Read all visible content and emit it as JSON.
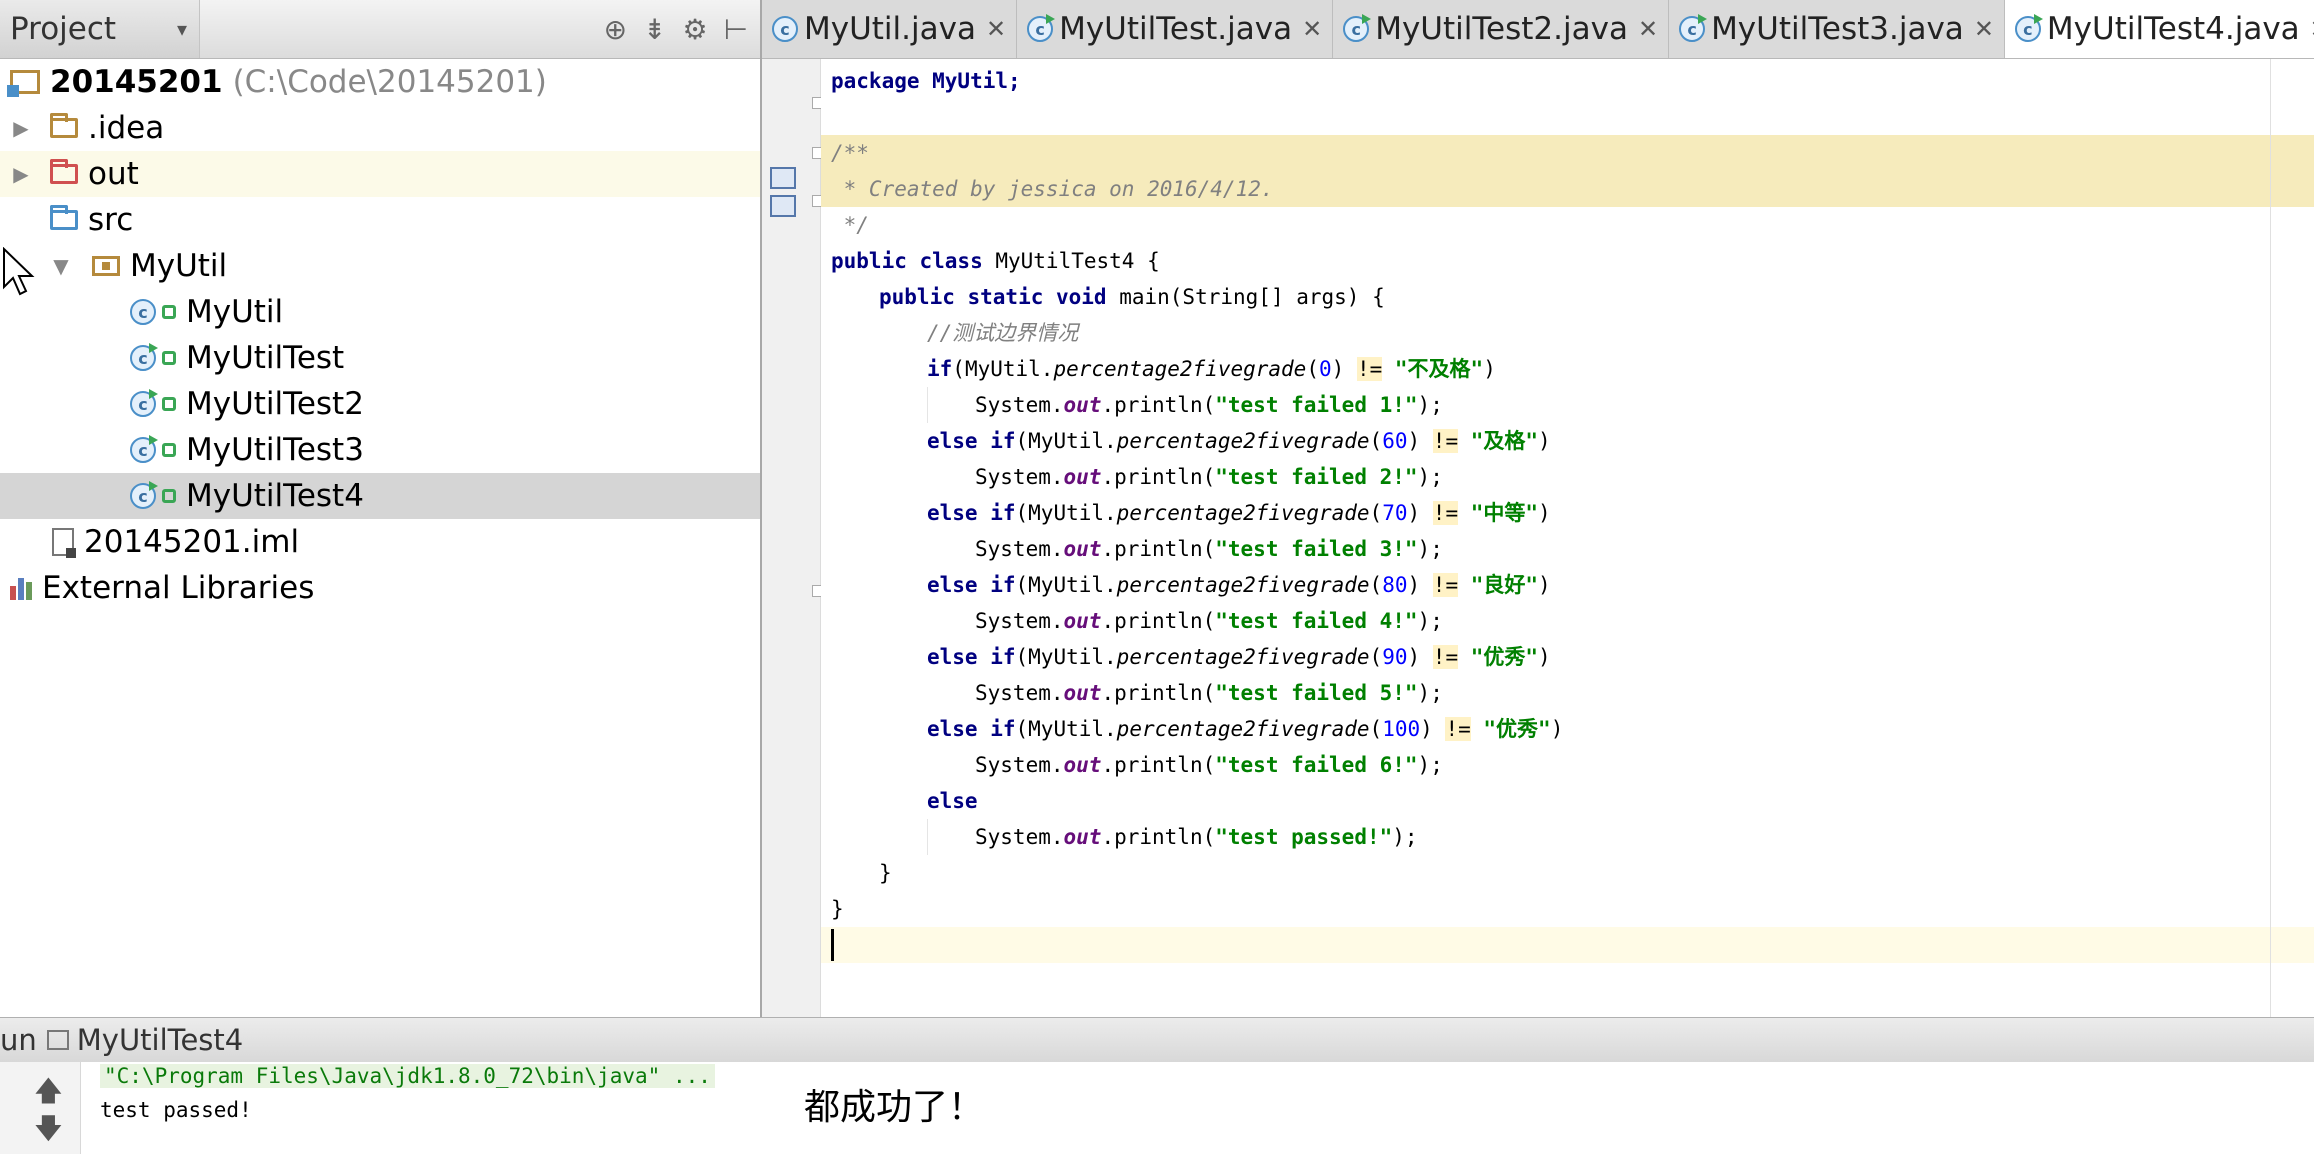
{
  "project_panel": {
    "title": "Project",
    "title_dropdown_icon": "chevron-down-icon",
    "tools": [
      "crosshair-icon",
      "collapse-icon",
      "gear-icon",
      "hide-icon"
    ],
    "root": {
      "name": "20145201",
      "path": "(C:\\Code\\20145201)"
    },
    "items": [
      {
        "label": ".idea",
        "icon": "folder-icon"
      },
      {
        "label": "out",
        "icon": "folder-excluded-icon"
      },
      {
        "label": "src",
        "icon": "source-folder-icon"
      },
      {
        "label": "MyUtil",
        "icon": "package-icon"
      },
      {
        "label": "MyUtil",
        "icon": "class-icon"
      },
      {
        "label": "MyUtilTest",
        "icon": "runnable-class-icon"
      },
      {
        "label": "MyUtilTest2",
        "icon": "runnable-class-icon"
      },
      {
        "label": "MyUtilTest3",
        "icon": "runnable-class-icon"
      },
      {
        "label": "MyUtilTest4",
        "icon": "runnable-class-icon",
        "selected": true
      },
      {
        "label": "20145201.iml",
        "icon": "module-file-icon"
      },
      {
        "label": "External Libraries",
        "icon": "library-icon"
      }
    ]
  },
  "editor": {
    "tabs": [
      {
        "label": "MyUtil.java",
        "active": false
      },
      {
        "label": "MyUtilTest.java",
        "active": false
      },
      {
        "label": "MyUtilTest2.java",
        "active": false
      },
      {
        "label": "MyUtilTest3.java",
        "active": false
      },
      {
        "label": "MyUtilTest4.java",
        "active": true
      }
    ],
    "code": {
      "l1": "package MyUtil;",
      "c1": "/**",
      "c2": " * Created by jessica on 2016/4/12.",
      "c3": " */",
      "l5_kw": "public class",
      "l5_name": " MyUtilTest4 {",
      "l6_kw": "public static void",
      "l6_rest": " main(String[] args) {",
      "l7": "//测试边界情况",
      "kw_if": "if",
      "kw_elseif": "else if",
      "kw_else": "else",
      "call_prefix": "(MyUtil.",
      "method": "percentage2fivegrade",
      "ne": "!=",
      "args": [
        "0",
        "60",
        "70",
        "80",
        "90",
        "100"
      ],
      "grades": [
        "\"不及格\"",
        "\"及格\"",
        "\"中等\"",
        "\"良好\"",
        "\"优秀\"",
        "\"优秀\""
      ],
      "print_prefix": "System.",
      "print_field": "out",
      "print_method": ".println(",
      "fail_msgs": [
        "\"test failed 1!\"",
        "\"test failed 2!\"",
        "\"test failed 3!\"",
        "\"test failed 4!\"",
        "\"test failed 5!\"",
        "\"test failed 6!\""
      ],
      "pass_msg": "\"test passed!\"",
      "close_inner": "}",
      "close_outer": "}"
    }
  },
  "run_panel": {
    "tab_prefix": "un",
    "config_name": "MyUtilTest4",
    "command": "\"C:\\Program Files\\Java\\jdk1.8.0_72\\bin\\java\" ...",
    "output": "test passed!",
    "up_icon": "arrow-up-icon",
    "down_icon": "arrow-down-icon"
  },
  "annotation": "都成功了！"
}
